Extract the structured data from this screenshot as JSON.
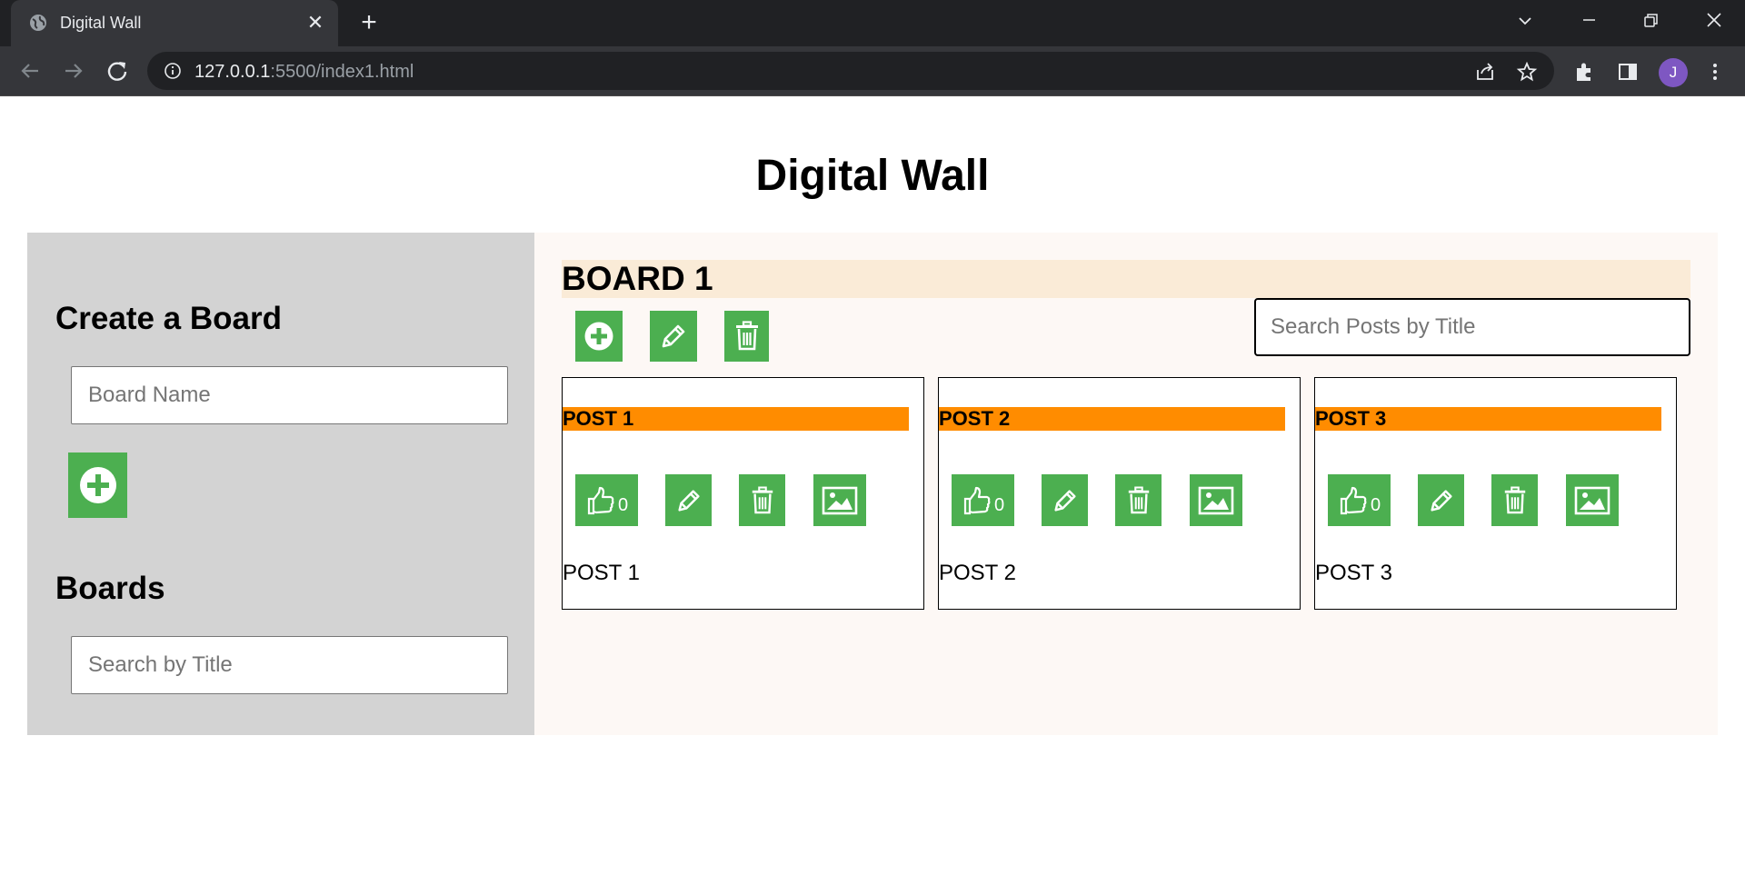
{
  "browser": {
    "tab_title": "Digital Wall",
    "url_host": "127.0.0.1",
    "url_rest": ":5500/index1.html",
    "avatar_initial": "J"
  },
  "page": {
    "title": "Digital Wall"
  },
  "sidebar": {
    "create_heading": "Create a Board",
    "board_name_placeholder": "Board Name",
    "boards_heading": "Boards",
    "search_placeholder": "Search by Title"
  },
  "board": {
    "title": "BOARD 1",
    "search_placeholder": "Search Posts by Title",
    "posts": [
      {
        "title": "POST 1",
        "likes": "0",
        "body": "POST 1"
      },
      {
        "title": "POST 2",
        "likes": "0",
        "body": "POST 2"
      },
      {
        "title": "POST 3",
        "likes": "0",
        "body": "POST 3"
      }
    ]
  },
  "colors": {
    "accent_green": "#4caf50",
    "post_header_orange": "#ff8c00",
    "board_header": "#faebd7",
    "sidebar_bg": "#d3d3d3"
  }
}
